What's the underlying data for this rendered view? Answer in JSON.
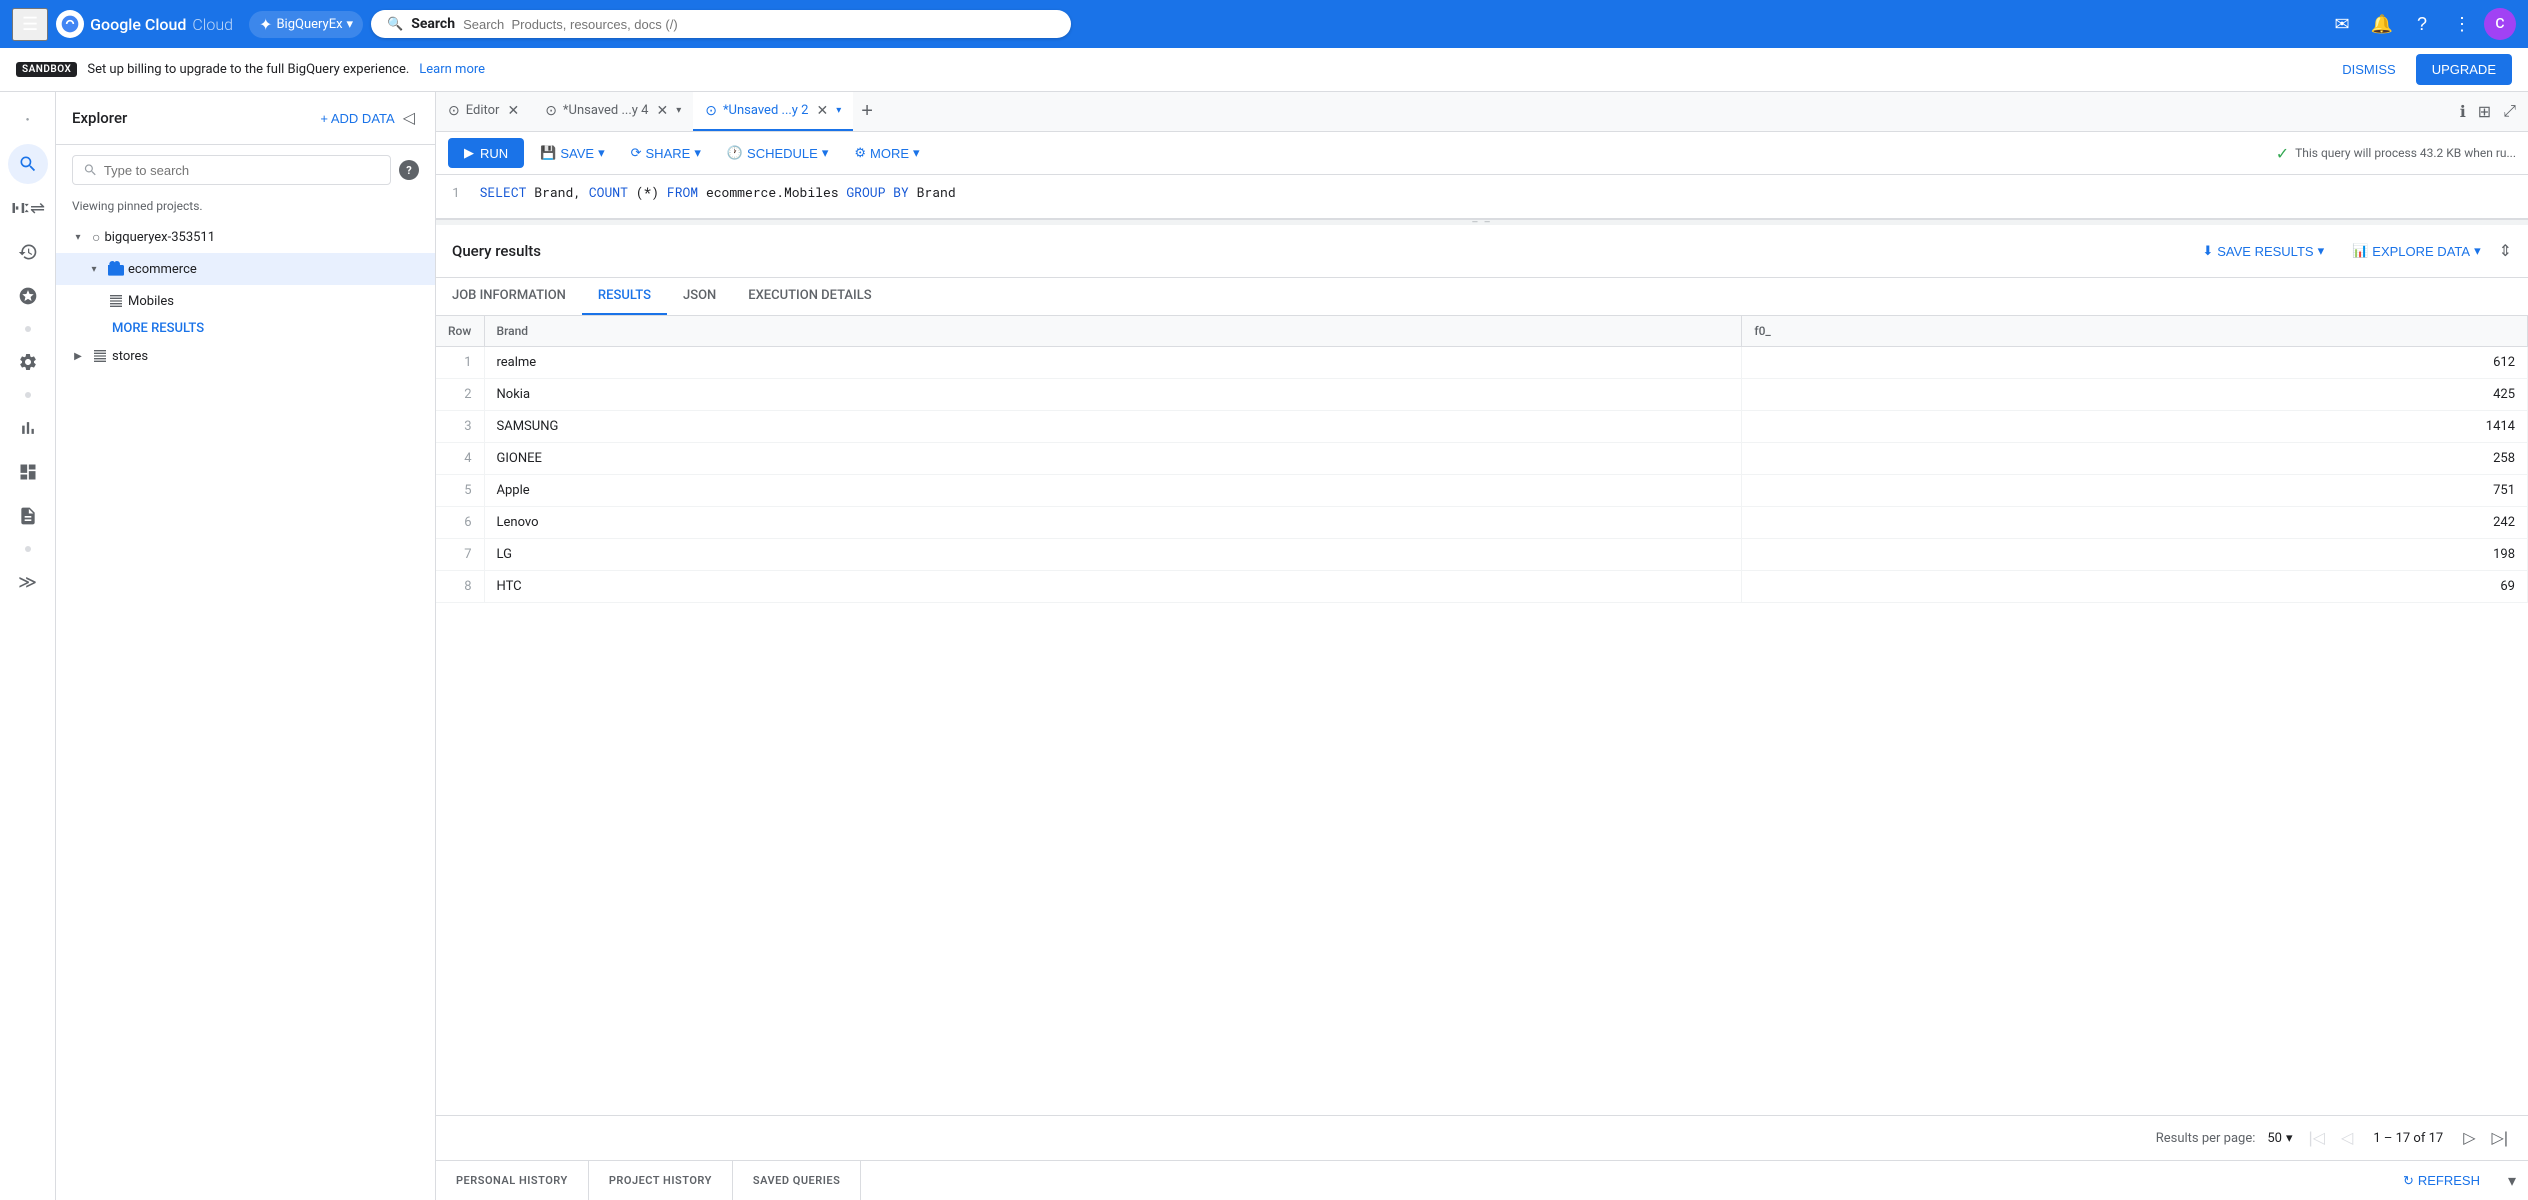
{
  "app": {
    "title": "Google Cloud",
    "project": "BigQueryEx",
    "search_placeholder": "Search  Products, resources, docs (/)"
  },
  "sandbox": {
    "badge": "SANDBOX",
    "message": "Set up billing to upgrade to the full BigQuery experience.",
    "link_text": "Learn more",
    "dismiss_label": "DISMISS",
    "upgrade_label": "UPGRADE"
  },
  "explorer": {
    "title": "Explorer",
    "add_data_label": "+ ADD DATA",
    "search_placeholder": "Type to search",
    "viewing_text": "Viewing pinned projects.",
    "projects": [
      {
        "name": "bigqueryex-353511",
        "expanded": true,
        "datasets": [
          {
            "name": "ecommerce",
            "expanded": true,
            "tables": [
              {
                "name": "Mobiles"
              }
            ]
          }
        ]
      },
      {
        "name": "stores",
        "expanded": false,
        "datasets": []
      }
    ],
    "more_results_label": "MORE RESULTS"
  },
  "tabs": [
    {
      "id": "editor",
      "label": "Editor",
      "icon": "⊙",
      "active": false,
      "closeable": true
    },
    {
      "id": "unsaved4",
      "label": "*Unsaved ...y 4",
      "icon": "⊙",
      "active": false,
      "closeable": true
    },
    {
      "id": "unsaved2",
      "label": "*Unsaved ...y 2",
      "icon": "⊙",
      "active": true,
      "closeable": true
    }
  ],
  "toolbar": {
    "run_label": "RUN",
    "save_label": "SAVE",
    "share_label": "SHARE",
    "schedule_label": "SCHEDULE",
    "more_label": "MORE",
    "process_info": "This query will process 43.2 KB when ru..."
  },
  "query": {
    "line": 1,
    "code": "SELECT Brand, COUNT(*) FROM ecommerce.Mobiles GROUP BY Brand"
  },
  "results": {
    "title": "Query results",
    "save_results_label": "SAVE RESULTS",
    "explore_data_label": "EXPLORE DATA",
    "tabs": [
      {
        "id": "job_info",
        "label": "JOB INFORMATION",
        "active": false
      },
      {
        "id": "results",
        "label": "RESULTS",
        "active": true
      },
      {
        "id": "json",
        "label": "JSON",
        "active": false
      },
      {
        "id": "execution",
        "label": "EXECUTION DETAILS",
        "active": false
      }
    ],
    "columns": [
      {
        "id": "row",
        "label": "Row"
      },
      {
        "id": "brand",
        "label": "Brand"
      },
      {
        "id": "f0_",
        "label": "f0_"
      }
    ],
    "rows": [
      {
        "row": "1",
        "brand": "realme",
        "count": "612"
      },
      {
        "row": "2",
        "brand": "Nokia",
        "count": "425"
      },
      {
        "row": "3",
        "brand": "SAMSUNG",
        "count": "1414"
      },
      {
        "row": "4",
        "brand": "GIONEE",
        "count": "258"
      },
      {
        "row": "5",
        "brand": "Apple",
        "count": "751"
      },
      {
        "row": "6",
        "brand": "Lenovo",
        "count": "242"
      },
      {
        "row": "7",
        "brand": "LG",
        "count": "198"
      },
      {
        "row": "8",
        "brand": "HTC",
        "count": "69"
      }
    ],
    "pagination": {
      "per_page_label": "Results per page:",
      "per_page": "50",
      "page_info": "1 – 17 of 17"
    }
  },
  "history_bar": {
    "personal_history_label": "PERSONAL HISTORY",
    "project_history_label": "PROJECT HISTORY",
    "saved_queries_label": "SAVED QUERIES",
    "refresh_label": "REFRESH"
  },
  "sidebar_icons": [
    {
      "name": "dot-nav",
      "icon": "•"
    },
    {
      "name": "search-nav",
      "icon": "🔍",
      "active": true
    },
    {
      "name": "filter-nav",
      "icon": "⇄"
    },
    {
      "name": "history-nav",
      "icon": "🕐"
    },
    {
      "name": "starred-nav",
      "icon": "☆"
    },
    {
      "name": "dot2-nav",
      "icon": "•"
    },
    {
      "name": "tools-nav",
      "icon": "🔧"
    },
    {
      "name": "dot3-nav",
      "icon": "•"
    },
    {
      "name": "chart-nav",
      "icon": "📊"
    },
    {
      "name": "dashboard-nav",
      "icon": "⊞"
    },
    {
      "name": "doc-nav",
      "icon": "📋"
    },
    {
      "name": "dot4-nav",
      "icon": "•"
    },
    {
      "name": "expand-nav",
      "icon": "≫"
    }
  ]
}
